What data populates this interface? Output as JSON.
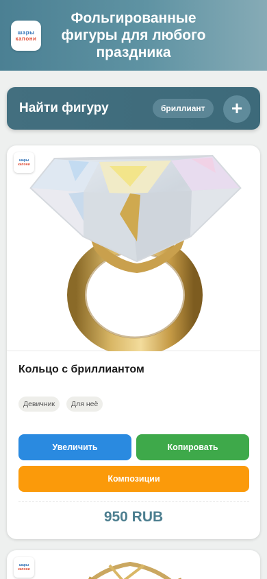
{
  "header": {
    "title": "Фольгированные фигуры для любого праздника",
    "logo_line1": "шары",
    "logo_line2": "капони"
  },
  "search": {
    "label": "Найти фигуру",
    "active_filter": "бриллиант",
    "add_symbol": "+"
  },
  "product": {
    "name": "Кольцо с бриллиантом",
    "tags": [
      "Девичник",
      "Для неё"
    ],
    "buttons": {
      "zoom": "Увеличить",
      "copy": "Копировать",
      "compositions": "Композиции"
    },
    "price": "950 RUB"
  },
  "colors": {
    "header_start": "#4b8093",
    "search_bg": "#436f7f",
    "zoom_btn": "#2a8ae0",
    "copy_btn": "#3ea94a",
    "comp_btn": "#fb9a0a",
    "price": "#4c7e8f"
  }
}
